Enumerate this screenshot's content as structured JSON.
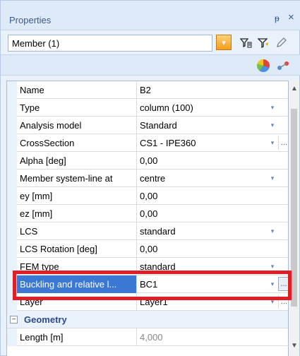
{
  "panel": {
    "title": "Properties",
    "pin_glyph": "ᵽ",
    "close_glyph": "×"
  },
  "member_selector": {
    "value": "Member (1)",
    "dropdown_glyph": "▾"
  },
  "toolbar_icons": [
    "select-filter-icon",
    "filter-icon",
    "pencil-icon"
  ],
  "toolbar2_icons": [
    "pie-chart-icon",
    "graph-icon"
  ],
  "grid": {
    "rows": [
      {
        "name": "Name",
        "value": "B2",
        "dropdown": false,
        "ellipsis": false
      },
      {
        "name": "Type",
        "value": "column (100)",
        "dropdown": true,
        "ellipsis": false
      },
      {
        "name": "Analysis model",
        "value": "Standard",
        "dropdown": true,
        "ellipsis": false
      },
      {
        "name": "CrossSection",
        "value": "CS1 - IPE360",
        "dropdown": true,
        "ellipsis": true
      },
      {
        "name": "Alpha [deg]",
        "value": "0,00",
        "dropdown": false,
        "ellipsis": false
      },
      {
        "name": "Member system-line at",
        "value": "centre",
        "dropdown": true,
        "ellipsis": false
      },
      {
        "name": "ey [mm]",
        "value": "0,00",
        "dropdown": false,
        "ellipsis": false
      },
      {
        "name": "ez [mm]",
        "value": "0,00",
        "dropdown": false,
        "ellipsis": false
      },
      {
        "name": "LCS",
        "value": "standard",
        "dropdown": true,
        "ellipsis": false
      },
      {
        "name": "LCS Rotation [deg]",
        "value": "0,00",
        "dropdown": false,
        "ellipsis": false
      },
      {
        "name": "FEM type",
        "value": "standard",
        "dropdown": true,
        "ellipsis": false
      },
      {
        "name": "Buckling and relative l...",
        "value": "BC1",
        "dropdown": true,
        "ellipsis": true,
        "selected": true
      },
      {
        "name": "Layer",
        "value": "Layer1",
        "dropdown": true,
        "ellipsis": true
      }
    ],
    "section": {
      "toggle": "−",
      "label": "Geometry"
    },
    "after_section": [
      {
        "name": "Length [m]",
        "value": "4,000",
        "gray": true
      }
    ],
    "dropdown_glyph": "▾",
    "ellipsis_glyph": "..."
  },
  "scrollbar": {
    "up": "▲",
    "down": "▼"
  },
  "colors": {
    "selection": "#3a78d4",
    "highlight_border": "#e01e25",
    "accent": "#f39c1a"
  }
}
